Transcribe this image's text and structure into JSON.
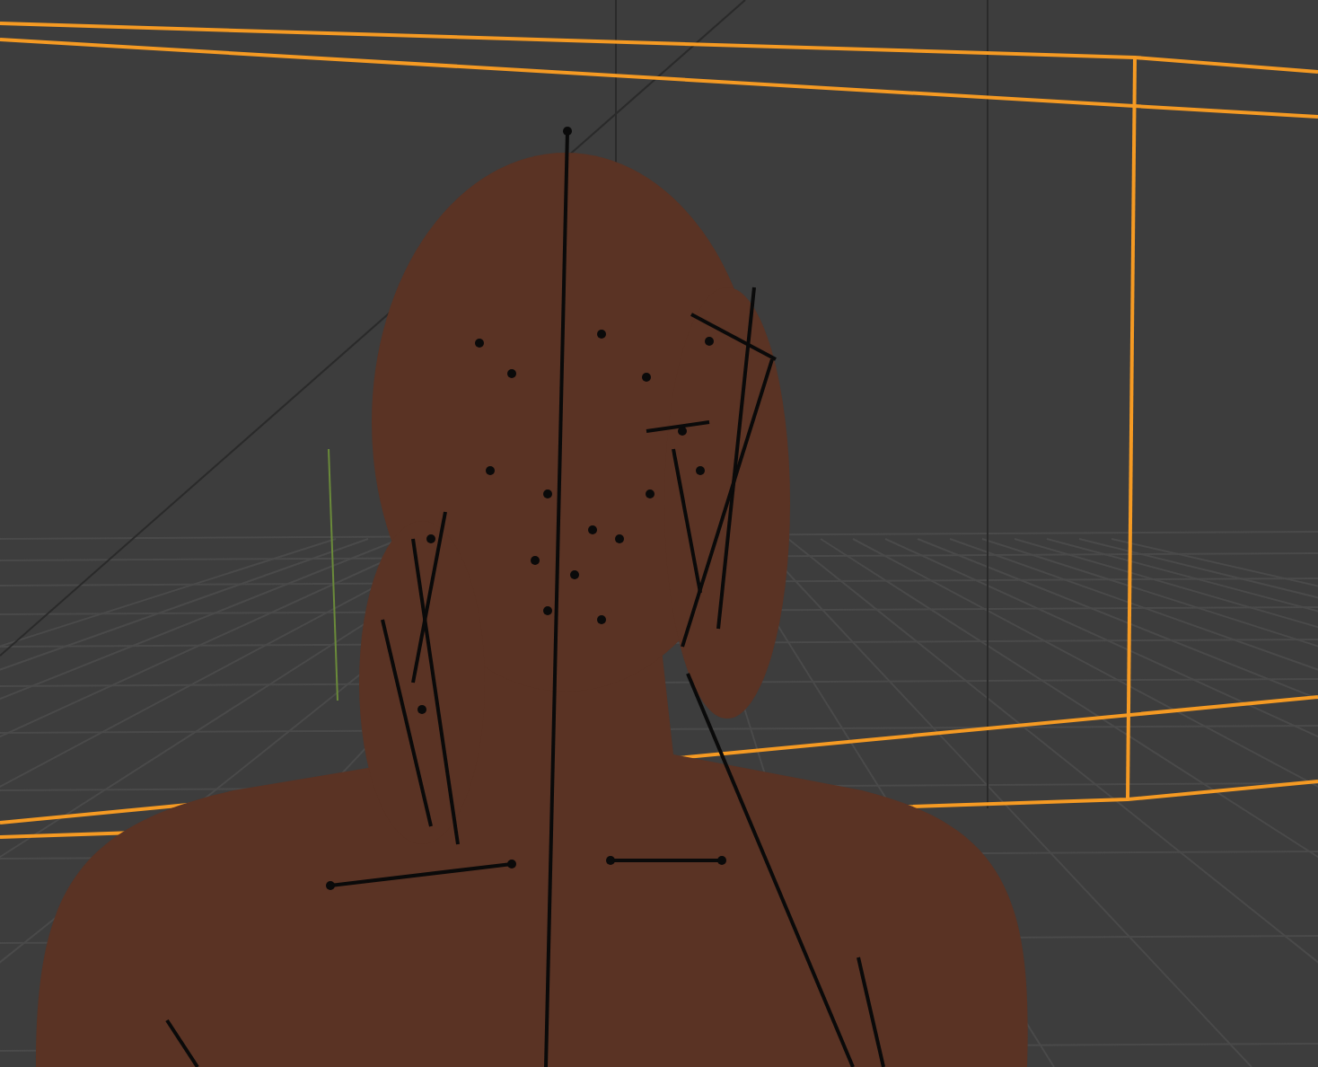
{
  "viewport": {
    "objects": [
      {
        "kind": "bounding_box",
        "selected": true
      }
    ]
  }
}
